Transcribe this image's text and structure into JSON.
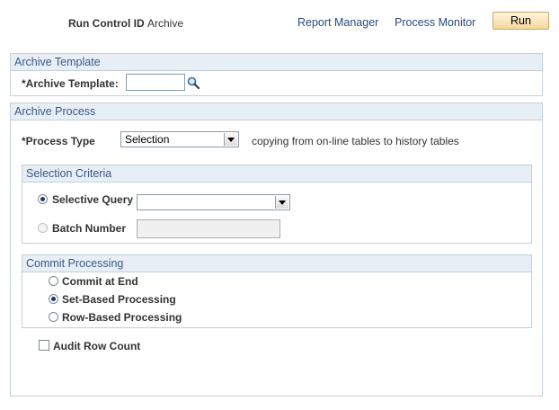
{
  "header": {
    "run_control_label": "Run Control ID",
    "run_control_value": "Archive",
    "report_manager": "Report Manager",
    "process_monitor": "Process Monitor",
    "run_button": "Run"
  },
  "archive_template": {
    "title": "Archive Template",
    "field_label": "*Archive Template:",
    "value": ""
  },
  "archive_process": {
    "title": "Archive Process",
    "process_type_label": "*Process Type",
    "process_type_value": "Selection",
    "process_type_desc": "copying from on-line tables to history tables",
    "selection_criteria": {
      "title": "Selection Criteria",
      "selective_query_label": "Selective Query",
      "selective_query_value": "",
      "batch_number_label": "Batch Number",
      "batch_number_value": ""
    },
    "commit_processing": {
      "title": "Commit Processing",
      "options": [
        "Commit at End",
        "Set-Based Processing",
        "Row-Based Processing"
      ],
      "selected": "Set-Based Processing"
    },
    "audit_row_count_label": "Audit Row Count"
  },
  "colors": {
    "group_header_bg": "#e8eef5",
    "group_header_text": "#3a5a88",
    "link": "#2a4a7a",
    "run_button": "#f6d79c"
  }
}
